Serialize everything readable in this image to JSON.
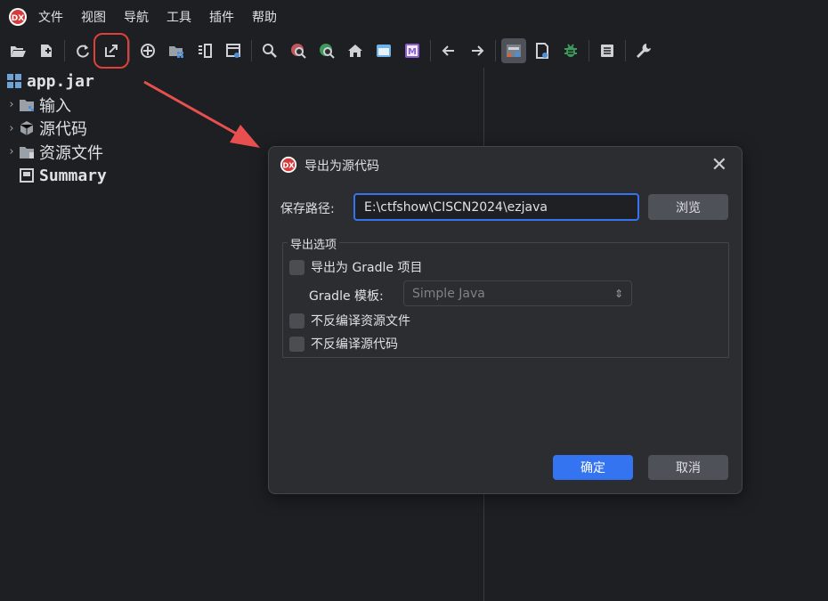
{
  "menubar": {
    "items": [
      "文件",
      "视图",
      "导航",
      "工具",
      "插件",
      "帮助"
    ]
  },
  "toolbar": {
    "icons": [
      "open-file-icon",
      "add-file-icon",
      "reload-icon",
      "export-icon",
      "target-icon",
      "package-icon",
      "split-view-icon",
      "log-icon",
      "search-icon",
      "find-class-icon",
      "find-usage-icon",
      "home-icon",
      "window-icon",
      "m-icon",
      "back-arrow-icon",
      "forward-arrow-icon",
      "decompile-icon",
      "deobf-icon",
      "debug-bug-icon",
      "summary-icon",
      "settings-wrench-icon"
    ],
    "highlighted": "export-icon",
    "highlight_color": "#e0403a"
  },
  "tree": {
    "root": "app.jar",
    "items": [
      {
        "label": "输入",
        "expandable": true
      },
      {
        "label": "源代码",
        "expandable": true
      },
      {
        "label": "资源文件",
        "expandable": true
      },
      {
        "label": "Summary",
        "expandable": false
      }
    ]
  },
  "dialog": {
    "title": "导出为源代码",
    "path_label": "保存路径:",
    "path_value": "E:\\ctfshow\\CISCN2024\\ezjava",
    "browse_label": "浏览",
    "group_title": "导出选项",
    "export_gradle_label": "导出为 Gradle 项目",
    "gradle_template_label": "Gradle 模板:",
    "gradle_template_value": "Simple Java",
    "no_res_label": "不反编译资源文件",
    "no_src_label": "不反编译源代码",
    "ok_label": "确定",
    "cancel_label": "取消"
  },
  "colors": {
    "accent": "#3574f0",
    "background": "#1e1f22",
    "dialog_bg": "#2b2d30"
  }
}
